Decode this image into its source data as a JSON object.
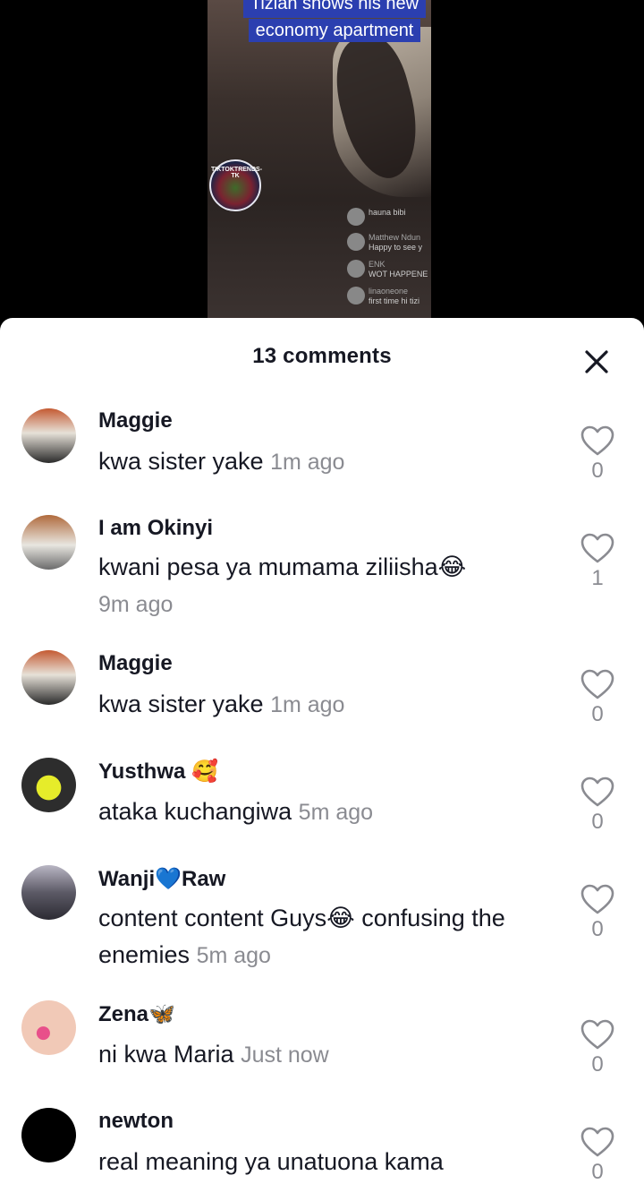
{
  "video": {
    "caption_line1": "Tizian shows his new",
    "caption_line2": "economy apartment",
    "watermark_text": "TIKTOKTRENDS-TK",
    "live_comments": [
      {
        "name": "",
        "text": "hauna bibi"
      },
      {
        "name": "Matthew Ndun",
        "text": "Happy to see y"
      },
      {
        "name": "ENK",
        "text": "WOT HAPPENE"
      },
      {
        "name": "linaoneone",
        "text": "first time hi tizi"
      }
    ]
  },
  "sheet": {
    "title": "13 comments",
    "close_icon": "close-icon"
  },
  "comments": [
    {
      "name": "Maggie",
      "text": "kwa sister yake",
      "time": "1m ago",
      "likes": "0",
      "avatar": "car"
    },
    {
      "name": "I am Okinyi",
      "text": "kwani pesa ya mumama ziliisha😂",
      "time": "9m ago",
      "likes": "1",
      "avatar": "person"
    },
    {
      "name": "Maggie",
      "text": "kwa sister yake",
      "time": "1m ago",
      "likes": "0",
      "avatar": "car"
    },
    {
      "name": "Yusthwa 🥰",
      "text": "ataka kuchangiwa",
      "time": "5m ago",
      "likes": "0",
      "avatar": "yellow-face"
    },
    {
      "name": "Wanji💙Raw",
      "text": "content content Guys😂 confusing the enemies",
      "time": "5m ago",
      "likes": "0",
      "avatar": "car"
    },
    {
      "name": "Zena🦋",
      "text": "ni kwa Maria",
      "time": "Just now",
      "likes": "0",
      "avatar": "nails"
    },
    {
      "name": "newton",
      "text": "real meaning ya unatuona kama",
      "time": "",
      "likes": "0",
      "avatar": "black"
    }
  ]
}
